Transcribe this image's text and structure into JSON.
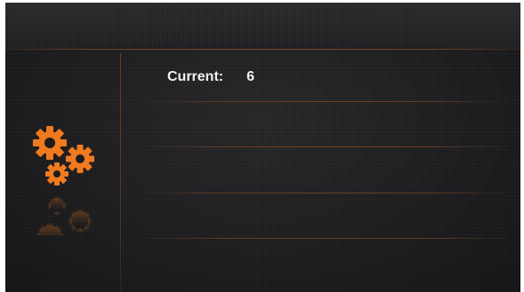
{
  "main": {
    "current_label": "Current:",
    "current_value": "6"
  },
  "icons": {
    "settings": "gears-icon"
  },
  "colors": {
    "accent": "#f07a1e",
    "background": "#1c1c1e",
    "divider": "#6b3f22",
    "text": "#f2f2f2"
  }
}
